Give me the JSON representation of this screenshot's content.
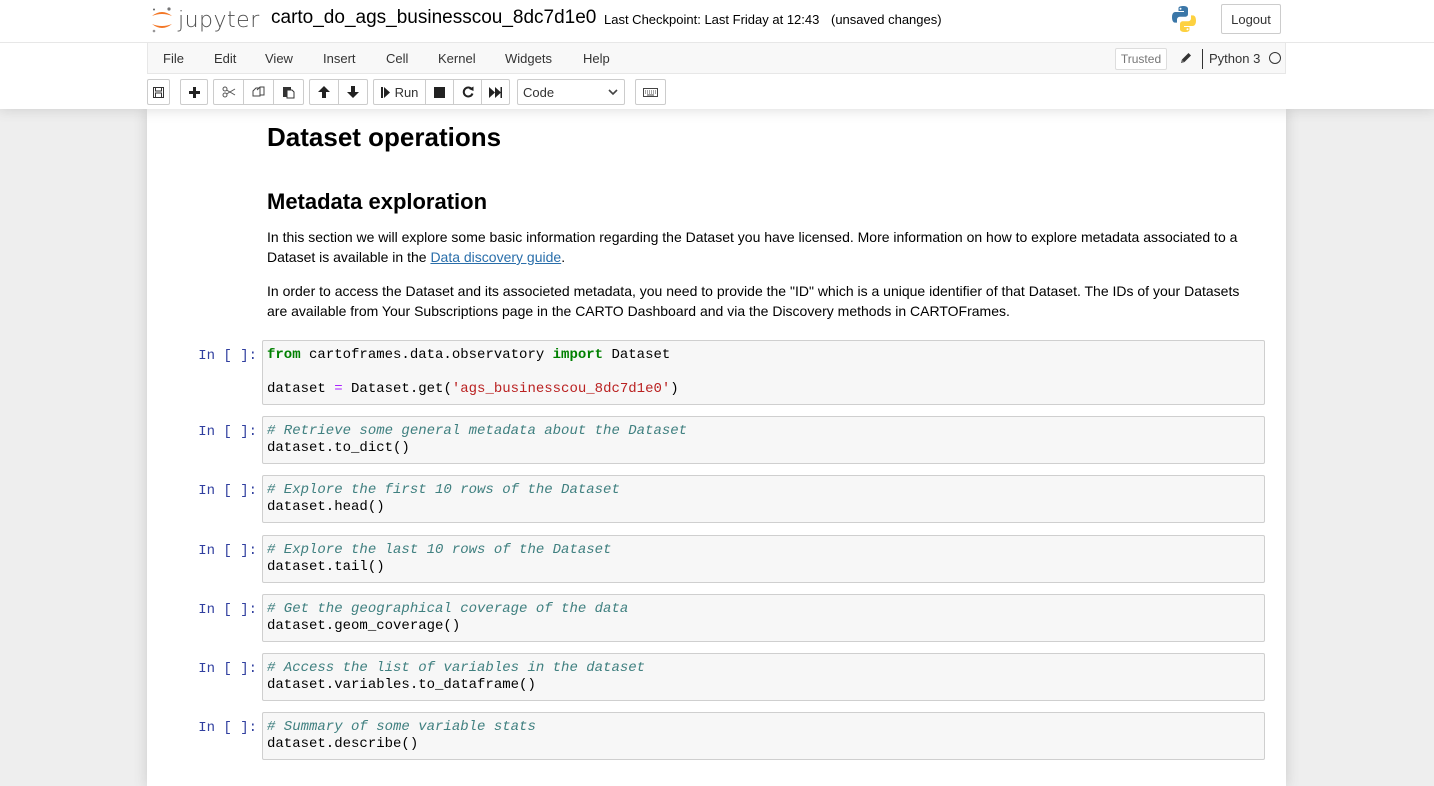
{
  "header": {
    "logo_text": "jupyter",
    "notebook_name": "carto_do_ags_businesscou_8dc7d1e0",
    "checkpoint": "Last Checkpoint: Last Friday at 12:43",
    "autosave_status": "(unsaved changes)",
    "logout_label": "Logout"
  },
  "menubar": {
    "items": [
      "File",
      "Edit",
      "View",
      "Insert",
      "Cell",
      "Kernel",
      "Widgets",
      "Help"
    ],
    "trusted_label": "Trusted",
    "kernel_name": "Python 3"
  },
  "toolbar": {
    "run_label": "Run",
    "cell_type": "Code",
    "buttons": [
      "save-icon",
      "plus-icon",
      "cut-icon",
      "copy-icon",
      "paste-icon",
      "arrow-up-icon",
      "arrow-down-icon",
      "step-forward-icon",
      "stop-icon",
      "restart-icon",
      "fast-forward-icon",
      "keyboard-icon"
    ]
  },
  "notebook": {
    "heading1": "Dataset operations",
    "heading2": "Metadata exploration",
    "para1_text": "In this section we will explore some basic information regarding the Dataset you have licensed. More information on how to explore metadata associated to a Dataset is available in the ",
    "para1_link": "Data discovery guide",
    "para1_end": ".",
    "para2": "In order to access the Dataset and its associeted metadata, you need to provide the \"ID\" which is a unique identifier of that Dataset. The IDs of your Datasets are available from Your Subscriptions page in the CARTO Dashboard and via the Discovery methods in CARTOFrames.",
    "prompt": "In [ ]:",
    "cells": [
      {
        "kw_from": "from",
        "module": " cartoframes.data.observatory ",
        "kw_import": "import",
        "name": " Dataset",
        "assign_lhs": "dataset ",
        "assign_op": "=",
        "call": " Dataset.get(",
        "arg": "'ags_businesscou_8dc7d1e0'",
        "close": ")"
      },
      {
        "comment": "# Retrieve some general metadata about the Dataset",
        "code": "dataset.to_dict()"
      },
      {
        "comment": "# Explore the first 10 rows of the Dataset",
        "code": "dataset.head()"
      },
      {
        "comment": "# Explore the last 10 rows of the Dataset",
        "code": "dataset.tail()"
      },
      {
        "comment": "# Get the geographical coverage of the data",
        "code": "dataset.geom_coverage()"
      },
      {
        "comment": "# Access the list of variables in the dataset",
        "code": "dataset.variables.to_dataframe()"
      },
      {
        "comment": "# Summary of some variable stats",
        "code": "dataset.describe()"
      }
    ]
  }
}
